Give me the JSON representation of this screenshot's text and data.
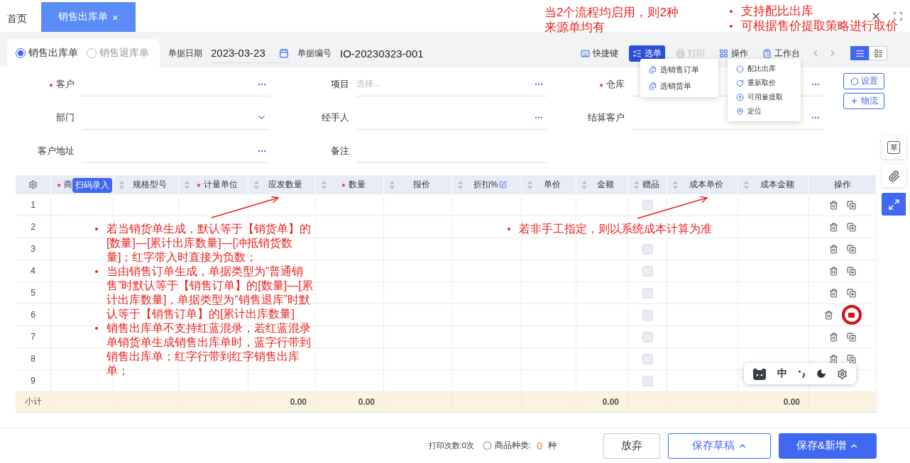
{
  "tabs": [
    {
      "label": "首页",
      "selected": false
    },
    {
      "label": "销售出库单",
      "selected": true,
      "close": "×"
    }
  ],
  "doc_types": [
    {
      "label": "销售出库单",
      "selected": true
    },
    {
      "label": "销售退库单",
      "selected": false
    }
  ],
  "date_field": {
    "label": "单据日期",
    "value": "2023-03-23"
  },
  "number_field": {
    "label": "单据编号",
    "value": "IO-20230323-001"
  },
  "toolbar": [
    {
      "label": "快捷键",
      "selected": false,
      "disabled": false
    },
    {
      "label": "选单",
      "selected": true,
      "disabled": false
    },
    {
      "label": "打印",
      "selected": false,
      "disabled": true
    },
    {
      "label": "操作",
      "selected": false,
      "disabled": false
    },
    {
      "label": "工作台",
      "selected": false,
      "disabled": false
    }
  ],
  "view_toggle": [
    {
      "selected": true
    },
    {
      "selected": false
    }
  ],
  "menus": [
    {
      "items": [
        "选销售订单",
        "选销货单"
      ]
    },
    {
      "items": [
        "配比出库",
        "重新取价",
        "可用量提取",
        "定位"
      ]
    }
  ],
  "form_fields": [
    {
      "label": "客户",
      "required": true,
      "kind": "lookup"
    },
    {
      "label": "项目",
      "required": false,
      "kind": "lookup",
      "placeholder": "选择..."
    },
    {
      "label": "仓库",
      "required": true,
      "kind": "lookup"
    },
    {
      "label": "部门",
      "required": false,
      "kind": "select"
    },
    {
      "label": "经手人",
      "required": false,
      "kind": "lookup"
    },
    {
      "label": "结算客户",
      "required": false,
      "kind": "lookup"
    },
    {
      "label": "客户地址",
      "required": false,
      "kind": "lookup"
    },
    {
      "label": "备注",
      "required": false,
      "kind": "text"
    }
  ],
  "side_buttons": [
    "设置",
    "物流"
  ],
  "side_tools": {
    "draft_label": "草",
    "expand_active": true
  },
  "table": {
    "badge": "扫码录入",
    "subtotal_label": "小计",
    "columns": [
      {
        "label": "商",
        "required": true,
        "sortable": false,
        "kind": "text"
      },
      {
        "label": "规格型号",
        "required": false,
        "sortable": true,
        "kind": "text"
      },
      {
        "label": "计量单位",
        "required": true,
        "sortable": true,
        "kind": "text"
      },
      {
        "label": "应发数量",
        "required": false,
        "sortable": true,
        "kind": "text",
        "subtotal": "0.00"
      },
      {
        "label": "数量",
        "required": true,
        "sortable": true,
        "kind": "text",
        "subtotal": "0.00"
      },
      {
        "label": "报价",
        "required": false,
        "sortable": true,
        "kind": "text"
      },
      {
        "label": "折扣%",
        "required": false,
        "sortable": true,
        "kind": "text",
        "editable": true
      },
      {
        "label": "单价",
        "required": false,
        "sortable": true,
        "kind": "text"
      },
      {
        "label": "金额",
        "required": false,
        "sortable": true,
        "kind": "text",
        "subtotal": "0.00"
      },
      {
        "label": "赠品",
        "required": false,
        "sortable": true,
        "kind": "checkbox"
      },
      {
        "label": "成本单价",
        "required": false,
        "sortable": true,
        "kind": "text"
      },
      {
        "label": "成本金额",
        "required": false,
        "sortable": true,
        "kind": "text",
        "subtotal": "0.00"
      },
      {
        "label": "操作",
        "required": false,
        "sortable": false,
        "kind": "actions"
      }
    ],
    "rows": [
      {
        "index": "1",
        "gift": false
      },
      {
        "index": "2"
      },
      {
        "index": "3",
        "gift": false
      },
      {
        "index": "4",
        "gift": false
      },
      {
        "index": "5",
        "gift": false
      },
      {
        "index": "6",
        "gift": false,
        "circled": true
      },
      {
        "index": "7",
        "gift": false
      },
      {
        "index": "8",
        "gift": false
      },
      {
        "index": "9",
        "gift": false,
        "actions_hidden": true
      }
    ]
  },
  "footer": {
    "print_count": "打印次数:0次",
    "kinds_label": "商品种类:",
    "kinds_count": "0",
    "kinds_unit": "种",
    "buttons": [
      {
        "label": "放弃",
        "kind": "plain",
        "menu": false
      },
      {
        "label": "保存草稿",
        "kind": "outline",
        "menu": true
      },
      {
        "label": "保存&新增",
        "kind": "primary",
        "menu": true
      }
    ]
  },
  "ime_bar": {
    "mode": "中"
  },
  "annotations": {
    "flow_note": "当2个流程均启用，则2种来源单均有",
    "feature_notes": [
      "支持配比出库",
      "可根据售价提取策略进行取价"
    ],
    "quantity_notes": [
      "若当销货单生成，默认等于【销货单】的[数量]—[累计出库数量]—[冲抵销货数量]；红字带入时直接为负数；",
      "当由销售订单生成，单据类型为“普通销售”时默认等于【销售订单】的[数量]—[累计出库数量]，单据类型为“销售退库”时默认等于【销售订单】的[累计出库数量]",
      "销售出库单不支持红蓝混录，若红蓝混录单销货单生成销售出库单时，蓝字行带到销售出库单；红字行带到红字销售出库单；"
    ],
    "cost_note": "若非手工指定，则以系统成本计算为准"
  }
}
